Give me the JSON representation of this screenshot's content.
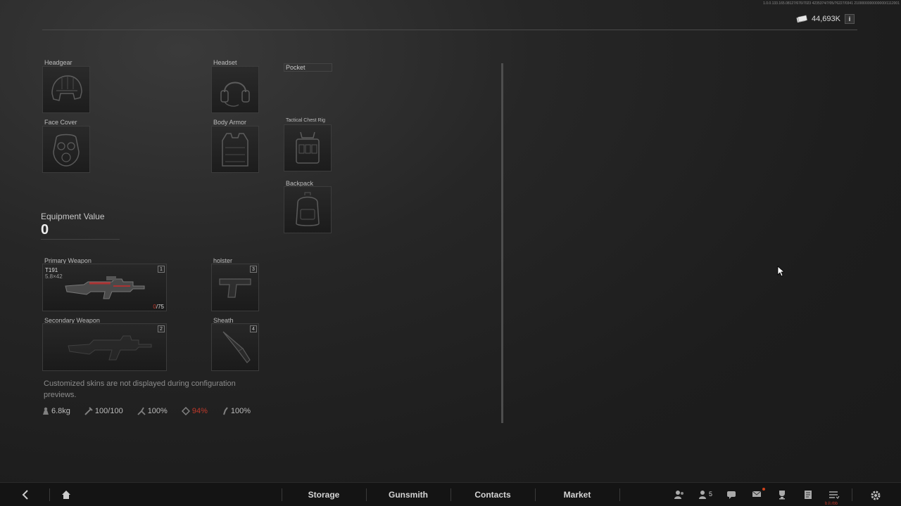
{
  "header": {
    "build_id": "1.0.0.133.165.08127/676/7023 4235374/7/05/76227/0341 2100000000000000/1112001",
    "currency_value": "44,693K",
    "info_label": "i"
  },
  "equipment_slots": {
    "headgear": "Headgear",
    "headset": "Headset",
    "face_cover": "Face Cover",
    "body_armor": "Body Armor",
    "pocket": "Pocket",
    "tactical_chest_rig": "Tactical Chest Rig",
    "backpack": "Backpack"
  },
  "equipment_value": {
    "label": "Equipment Value",
    "value": "0"
  },
  "weapons": {
    "primary": {
      "label": "Primary Weapon",
      "name": "T191",
      "caliber": "5.8×42",
      "ammo_current": "0",
      "ammo_max": "/75",
      "slot_number": "1"
    },
    "secondary": {
      "label": "Secondary Weapon",
      "slot_number": "2"
    },
    "holster": {
      "label": "holster",
      "slot_number": "3"
    },
    "sheath": {
      "label": "Sheath",
      "slot_number": "4"
    }
  },
  "note": "Customized skins are not displayed during configuration previews.",
  "stats": {
    "weight": "6.8kg",
    "durability": "100/100",
    "stat2": "100%",
    "stat3": "94%",
    "stat4": "100%"
  },
  "bottom_nav": {
    "tabs": [
      "Storage",
      "Gunsmith",
      "Contacts",
      "Market"
    ],
    "friends_count": "5",
    "red_tag": "b.ll.rbb"
  },
  "colors": {
    "accent_red": "#c0392b",
    "background": "#1d1d1d",
    "bar": "#141414"
  }
}
